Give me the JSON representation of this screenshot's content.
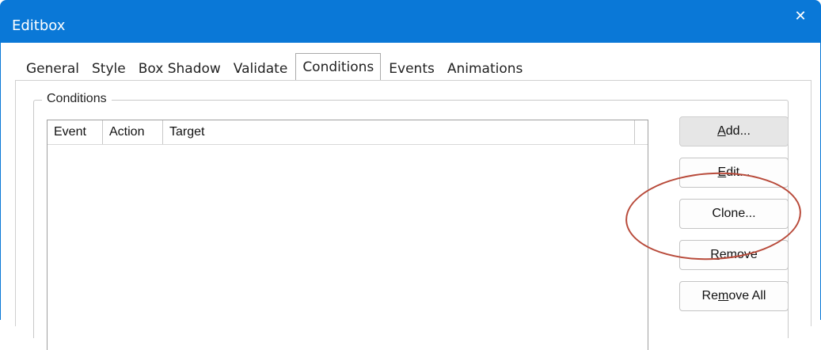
{
  "window": {
    "title": "Editbox",
    "close_glyph": "✕",
    "titlebar_color": "#0a78d7"
  },
  "tabs": [
    {
      "label": "General",
      "active": false
    },
    {
      "label": "Style",
      "active": false
    },
    {
      "label": "Box Shadow",
      "active": false
    },
    {
      "label": "Validate",
      "active": false
    },
    {
      "label": "Conditions",
      "active": true
    },
    {
      "label": "Events",
      "active": false
    },
    {
      "label": "Animations",
      "active": false
    }
  ],
  "conditions_group": {
    "legend": "Conditions",
    "columns": [
      "Event",
      "Action",
      "Target"
    ],
    "rows": []
  },
  "buttons": {
    "add": {
      "pre": "",
      "mnemonic": "A",
      "post": "dd..."
    },
    "edit": {
      "pre": "",
      "mnemonic": "E",
      "post": "dit..."
    },
    "clone": {
      "pre": "",
      "mnemonic": "",
      "post": "Clone..."
    },
    "remove": {
      "pre": "",
      "mnemonic": "R",
      "post": "emove"
    },
    "remove_all": {
      "pre": "Re",
      "mnemonic": "m",
      "post": "ove All"
    }
  },
  "annotation_color": "#b84a3a"
}
